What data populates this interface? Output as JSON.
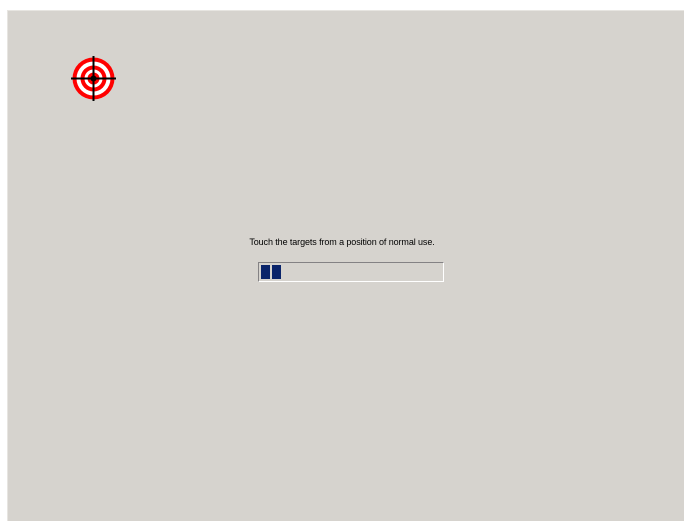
{
  "calibration": {
    "instruction": "Touch the targets from a position of normal use.",
    "progress": {
      "completed_chunks": 2,
      "color": "#0a246a"
    },
    "target": {
      "icon": "crosshair-target-icon",
      "ring_color": "#ff0000",
      "crosshair_color": "#000000"
    }
  },
  "colors": {
    "surface": "#d6d3ce"
  }
}
